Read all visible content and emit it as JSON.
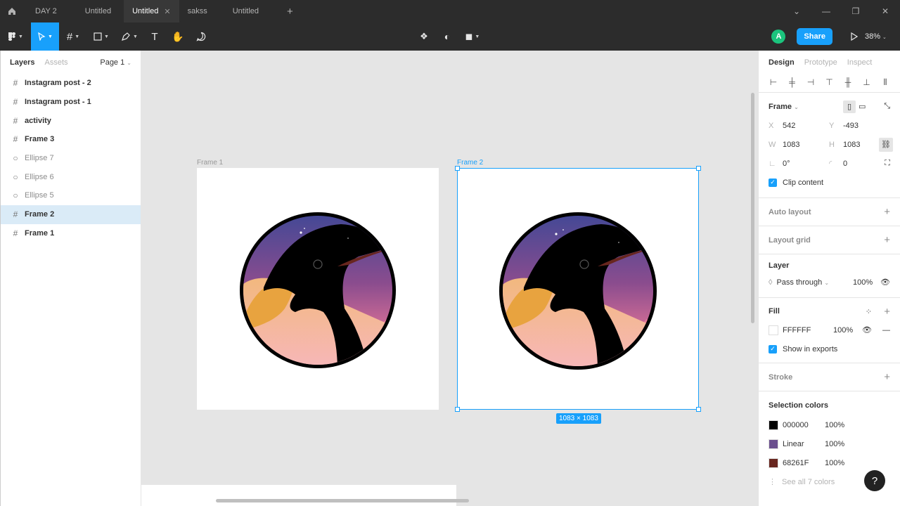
{
  "tabs": [
    {
      "label": "DAY 2",
      "active": false
    },
    {
      "label": "Untitled",
      "active": false
    },
    {
      "label": "Untitled",
      "active": true
    },
    {
      "label": "sakss",
      "active": false
    },
    {
      "label": "Untitled",
      "active": false
    }
  ],
  "toolbar": {
    "avatar_initial": "A",
    "share_label": "Share",
    "zoom": "38%"
  },
  "left_panel": {
    "tab_layers": "Layers",
    "tab_assets": "Assets",
    "page": "Page 1",
    "layers": [
      {
        "name": "Instagram post - 2",
        "type": "frame"
      },
      {
        "name": "Instagram post - 1",
        "type": "frame"
      },
      {
        "name": "activity",
        "type": "frame"
      },
      {
        "name": "Frame 3",
        "type": "frame"
      },
      {
        "name": "Ellipse 7",
        "type": "ellipse"
      },
      {
        "name": "Ellipse 6",
        "type": "ellipse"
      },
      {
        "name": "Ellipse 5",
        "type": "ellipse"
      },
      {
        "name": "Frame 2",
        "type": "frame",
        "selected": true
      },
      {
        "name": "Frame 1",
        "type": "frame"
      }
    ]
  },
  "canvas": {
    "frame1_label": "Frame 1",
    "frame2_label": "Frame 2",
    "size_badge": "1083 × 1083"
  },
  "right_panel": {
    "tab_design": "Design",
    "tab_prototype": "Prototype",
    "tab_inspect": "Inspect",
    "frame_label": "Frame",
    "x_label": "X",
    "x": "542",
    "y_label": "Y",
    "y": "-493",
    "w_label": "W",
    "w": "1083",
    "h_label": "H",
    "h": "1083",
    "rotation": "0°",
    "radius": "0",
    "clip_content": "Clip content",
    "auto_layout": "Auto layout",
    "layout_grid": "Layout grid",
    "layer_title": "Layer",
    "blend_mode": "Pass through",
    "layer_opacity": "100%",
    "fill_title": "Fill",
    "fill_hex": "FFFFFF",
    "fill_opacity": "100%",
    "show_in_exports": "Show in exports",
    "stroke_title": "Stroke",
    "selection_colors_title": "Selection colors",
    "selection_colors": [
      {
        "name": "000000",
        "opacity": "100%",
        "color": "#000000"
      },
      {
        "name": "Linear",
        "opacity": "100%",
        "color": "#6b4f8e"
      },
      {
        "name": "68261F",
        "opacity": "100%",
        "color": "#68261F"
      }
    ],
    "see_all": "See all 7 colors"
  },
  "help_label": "?",
  "colors": {
    "accent": "#18a0fb",
    "toolbar_bg": "#2c2c2c",
    "canvas_bg": "#e5e5e5",
    "avatar": "#1bc47d"
  }
}
